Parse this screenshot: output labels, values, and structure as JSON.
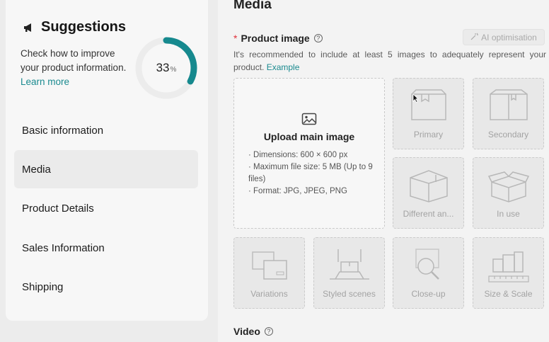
{
  "sidebar": {
    "suggestions_title": "Suggestions",
    "suggestions_text": "Check how to improve your product information.",
    "learn_more": "Learn more",
    "progress_value": "33",
    "progress_unit": "%",
    "progress_fraction": 0.33,
    "nav": [
      {
        "label": "Basic information",
        "active": false
      },
      {
        "label": "Media",
        "active": true
      },
      {
        "label": "Product Details",
        "active": false
      },
      {
        "label": "Sales Information",
        "active": false
      },
      {
        "label": "Shipping",
        "active": false
      }
    ]
  },
  "main": {
    "section_title": "Media",
    "product_image_label": "Product image",
    "required_marker": "*",
    "ai_button": "AI optimisation",
    "recommendation": "It's recommended to include at least 5 images to adequately represent your product.",
    "example_link": "Example",
    "upload": {
      "title": "Upload main image",
      "specs": [
        "· Dimensions: 600 × 600 px",
        "· Maximum file size: 5 MB (Up to 9 files)",
        "· Format: JPG, JPEG, PNG"
      ]
    },
    "slots": [
      "Primary",
      "Secondary",
      "Different an...",
      "In use",
      "Variations",
      "Styled scenes",
      "Close-up",
      "Size & Scale"
    ],
    "video_label": "Video"
  },
  "colors": {
    "accent": "#1a8a8f",
    "required": "#e0303a"
  }
}
